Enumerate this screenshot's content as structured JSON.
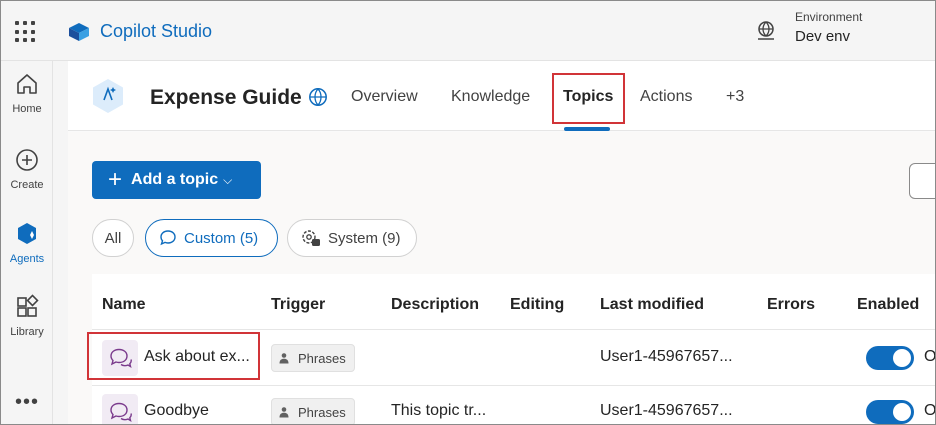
{
  "app": {
    "title": "Copilot Studio",
    "environment_label": "Environment",
    "environment_value": "Dev env"
  },
  "rail": {
    "items": [
      {
        "label": "Home",
        "icon": "home-icon"
      },
      {
        "label": "Create",
        "icon": "plus-circle-icon"
      },
      {
        "label": "Agents",
        "icon": "agents-icon",
        "active": true
      },
      {
        "label": "Library",
        "icon": "library-icon"
      }
    ],
    "more": "•••"
  },
  "agent": {
    "name": "Expense Guide",
    "tabs": [
      {
        "label": "Overview"
      },
      {
        "label": "Knowledge"
      },
      {
        "label": "Topics",
        "active": true
      },
      {
        "label": "Actions"
      },
      {
        "label": "+3"
      }
    ]
  },
  "toolbar": {
    "add_label": "Add a topic",
    "add_chevron": "⌵"
  },
  "filters": {
    "all": "All",
    "custom": "Custom (5)",
    "system": "System (9)"
  },
  "table": {
    "headers": [
      "Name",
      "Trigger",
      "Description",
      "Editing",
      "Last modified",
      "Errors",
      "Enabled"
    ],
    "rows": [
      {
        "name": "Ask about ex...",
        "trigger": "Phrases",
        "description": "",
        "editing": "",
        "last_modified": "User1-45967657...",
        "errors": "",
        "enabled_text": "O"
      },
      {
        "name": "Goodbye",
        "trigger": "Phrases",
        "description": "This topic tr...",
        "editing": "",
        "last_modified": "User1-45967657...",
        "errors": "",
        "enabled_text": "O"
      }
    ]
  },
  "colors": {
    "accent": "#0f6cbd",
    "highlight": "#d13438",
    "topic_icon_bg": "#f1ebf4"
  }
}
